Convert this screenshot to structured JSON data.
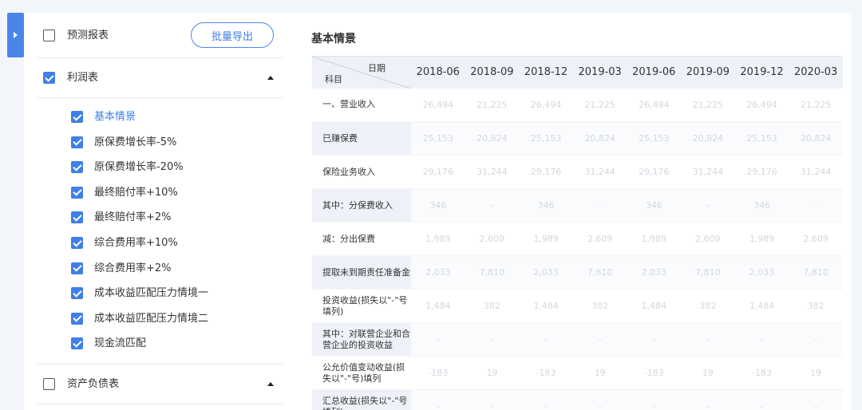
{
  "left_panel": {
    "forecast_report_label": "预测报表",
    "export_button": "批量导出",
    "income_statement": {
      "label": "利润表",
      "items": [
        {
          "label": "基本情景",
          "checked": true,
          "active": true
        },
        {
          "label": "原保费增长率-5%",
          "checked": true
        },
        {
          "label": "原保费增长率-20%",
          "checked": true
        },
        {
          "label": "最终赔付率+10%",
          "checked": true
        },
        {
          "label": "最终赔付率+2%",
          "checked": true
        },
        {
          "label": "综合费用率+10%",
          "checked": true
        },
        {
          "label": "综合费用率+2%",
          "checked": true
        },
        {
          "label": "成本收益匹配压力情境一",
          "checked": true
        },
        {
          "label": "成本收益匹配压力情境二",
          "checked": true
        },
        {
          "label": "现金流匹配",
          "checked": true
        }
      ]
    },
    "balance_sheet_label": "资产负债表"
  },
  "main": {
    "title": "基本情景",
    "table": {
      "corner_date": "日期",
      "corner_subject": "科目",
      "columns": [
        "2018-06",
        "2018-09",
        "2018-12",
        "2019-03",
        "2019-06",
        "2019-09",
        "2019-12",
        "2020-03"
      ],
      "rows": [
        {
          "subject": "一、营业收入",
          "values": [
            "26,494",
            "21,225",
            "26,494",
            "21,225",
            "26,494",
            "21,225",
            "26,494",
            "21,225"
          ]
        },
        {
          "subject": "已赚保费",
          "values": [
            "25,153",
            "20,824",
            "25,153",
            "20,824",
            "25,153",
            "20,824",
            "25,153",
            "20,824"
          ]
        },
        {
          "subject": "保险业务收入",
          "values": [
            "29,176",
            "31,244",
            "29,176",
            "31,244",
            "29,176",
            "31,244",
            "29,176",
            "31,244"
          ]
        },
        {
          "subject": "其中：分保费收入",
          "values": [
            "346",
            "-",
            "346",
            "-",
            "346",
            "-",
            "346",
            "-"
          ]
        },
        {
          "subject": "减：分出保费",
          "values": [
            "1,989",
            "2,609",
            "1,989",
            "2,609",
            "1,989",
            "2,609",
            "1,989",
            "2,609"
          ]
        },
        {
          "subject": "提取未到期责任准备金",
          "values": [
            "2,033",
            "7,810",
            "2,033",
            "7,810",
            "2,033",
            "7,810",
            "2,033",
            "7,810"
          ]
        },
        {
          "subject": "投资收益(损失以\"-\"号填列)",
          "values": [
            "1,484",
            "382",
            "1,484",
            "382",
            "1,484",
            "382",
            "1,484",
            "382"
          ]
        },
        {
          "subject": "其中：对联营企业和合营企业的投资收益",
          "values": [
            "-",
            "-",
            "-",
            "-",
            "-",
            "-",
            "-",
            "-"
          ]
        },
        {
          "subject": "公允价值变动收益(损失以\"-\"号)填列",
          "values": [
            "-183",
            "19",
            "-183",
            "19",
            "-183",
            "19",
            "-183",
            "19"
          ]
        },
        {
          "subject": "汇总收益(损失以\"-\"号填列)",
          "values": [
            "-",
            "-",
            "-",
            "-",
            "-",
            "-",
            "-",
            "-"
          ]
        }
      ]
    }
  },
  "colors": {
    "accent": "#3f7fe6",
    "header_bg": "#eef2f8"
  }
}
